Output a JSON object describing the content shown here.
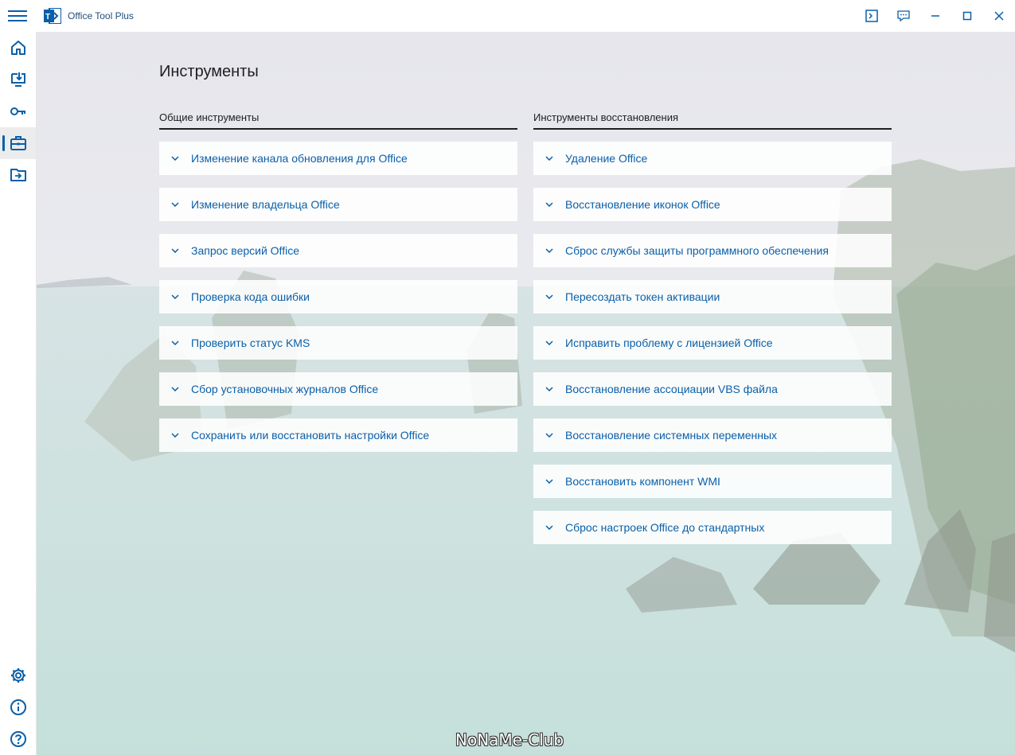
{
  "app": {
    "title": "Office Tool Plus"
  },
  "page": {
    "title": "Инструменты"
  },
  "sections": {
    "general": {
      "header": "Общие инструменты",
      "items": [
        "Изменение канала обновления для Office",
        "Изменение владельца Office",
        "Запрос версий Office",
        "Проверка кода ошибки",
        "Проверить статус KMS",
        "Сбор установочных журналов Office",
        "Сохранить или восстановить настройки Office"
      ]
    },
    "repair": {
      "header": "Инструменты восстановления",
      "items": [
        "Удаление Office",
        "Восстановление иконок Office",
        "Сброс службы защиты программного обеспечения",
        "Пересоздать токен активации",
        "Исправить проблему с лицензией Office",
        "Восстановление ассоциации VBS файла",
        "Восстановление системных переменных",
        "Восстановить компонент WMI",
        "Сброс настроек Office до стандартных"
      ]
    }
  },
  "titlebar_icons": [
    "console-icon",
    "feedback-icon",
    "minimize-icon",
    "maximize-icon",
    "close-icon"
  ],
  "sidebar_icons": [
    "home-icon",
    "deploy-icon",
    "activation-icon",
    "toolbox-icon",
    "convert-icon",
    "settings-icon",
    "about-icon",
    "help-icon"
  ],
  "watermark": "NoNaMe-Club",
  "colors": {
    "accent": "#0a5fa8",
    "card_bg": "#ffffff"
  }
}
